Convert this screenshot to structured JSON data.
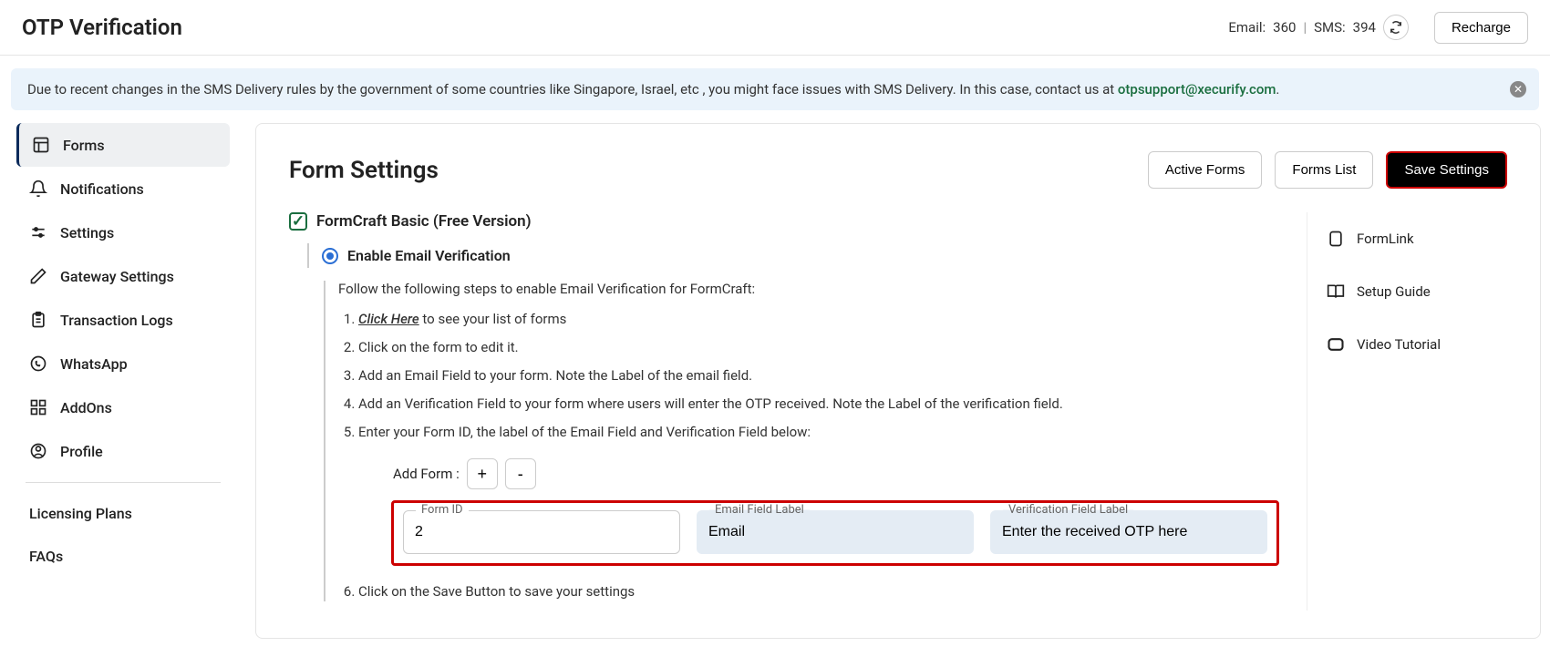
{
  "header": {
    "title": "OTP Verification",
    "email_label": "Email:",
    "email_count": "360",
    "sms_label": "SMS:",
    "sms_count": "394",
    "recharge": "Recharge"
  },
  "alert": {
    "text_before": "Due to recent changes in the SMS Delivery rules by the government of some countries like Singapore, Israel, etc , you might face issues with SMS Delivery. In this case, contact us at ",
    "email": "otpsupport@xecurify.com",
    "text_after": "."
  },
  "sidebar": {
    "items": [
      {
        "label": "Forms"
      },
      {
        "label": "Notifications"
      },
      {
        "label": "Settings"
      },
      {
        "label": "Gateway Settings"
      },
      {
        "label": "Transaction Logs"
      },
      {
        "label": "WhatsApp"
      },
      {
        "label": "AddOns"
      },
      {
        "label": "Profile"
      }
    ],
    "licensing": "Licensing Plans",
    "faqs": "FAQs"
  },
  "main": {
    "title": "Form Settings",
    "buttons": {
      "active_forms": "Active Forms",
      "forms_list": "Forms List",
      "save": "Save Settings"
    },
    "section_label": "FormCraft Basic (Free Version)",
    "radio_label": "Enable Email Verification",
    "intro": "Follow the following steps to enable Email Verification for FormCraft:",
    "step1_link": "Click Here",
    "step1_rest": " to see your list of forms",
    "step2": "Click on the form to edit it.",
    "step3": "Add an Email Field to your form. Note the Label of the email field.",
    "step4": "Add an Verification Field to your form where users will enter the OTP received. Note the Label of the verification field.",
    "step5": "Enter your Form ID, the label of the Email Field and Verification Field below:",
    "step6": "Click on the Save Button to save your settings",
    "addform_label": "Add Form :",
    "fields": {
      "form_id_label": "Form ID",
      "form_id_value": "2",
      "email_label": "Email Field Label",
      "email_value": "Email",
      "verif_label": "Verification Field Label",
      "verif_value": "Enter the received OTP here"
    },
    "right_links": {
      "formlink": "FormLink",
      "setup": "Setup Guide",
      "video": "Video Tutorial"
    }
  }
}
